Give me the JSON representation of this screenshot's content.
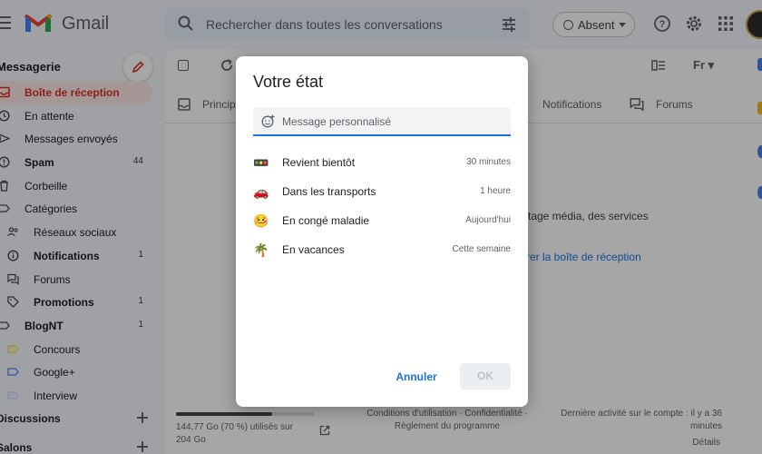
{
  "app": {
    "name": "Gmail"
  },
  "search": {
    "placeholder": "Rechercher dans toutes les conversations"
  },
  "status": {
    "label": "Absent"
  },
  "sidebar": {
    "section_title": "Messagerie",
    "items": [
      {
        "label": "Boîte de réception",
        "count": "",
        "icon": "inbox-icon"
      },
      {
        "label": "En attente",
        "count": "",
        "icon": "clock-icon"
      },
      {
        "label": "Messages envoyés",
        "count": "",
        "icon": "send-icon"
      },
      {
        "label": "Spam",
        "count": "44",
        "icon": "spam-icon"
      },
      {
        "label": "Corbeille",
        "count": "",
        "icon": "trash-icon"
      },
      {
        "label": "Catégories",
        "count": "",
        "icon": "label-icon"
      },
      {
        "label": "Réseaux sociaux",
        "count": "",
        "icon": "people-icon"
      },
      {
        "label": "Notifications",
        "count": "1",
        "icon": "info-icon"
      },
      {
        "label": "Forums",
        "count": "",
        "icon": "forum-icon"
      },
      {
        "label": "Promotions",
        "count": "1",
        "icon": "tag-icon"
      },
      {
        "label": "BlogNT",
        "count": "1",
        "icon": "label-icon"
      },
      {
        "label": "Concours",
        "count": "",
        "icon": "label-icon"
      },
      {
        "label": "Google+",
        "count": "",
        "icon": "label-icon"
      },
      {
        "label": "Interview",
        "count": "",
        "icon": "label-icon"
      }
    ],
    "discussions": "Discussions",
    "salons": "Salons"
  },
  "main": {
    "tabs": [
      "Princip",
      "Notifications",
      "Forums"
    ],
    "bg_text": "rtage média, des services",
    "bg_link": "rer la boîte de réception",
    "storage_text": "144,77 Go (70 %) utilisés sur 204 Go",
    "storage_pct": 70,
    "footer_terms": "Conditions d'utilisation · Confidentialité · Règlement du programme",
    "footer_activity": "Dernière activité sur le compte : il y a 36 minutes",
    "footer_details": "Détails"
  },
  "dialog": {
    "title": "Votre état",
    "input_placeholder": "Message personnalisé",
    "options": [
      {
        "label": "Revient bientôt",
        "time": "30 minutes",
        "icon": "🚥"
      },
      {
        "label": "Dans les transports",
        "time": "1 heure",
        "icon": "🚗"
      },
      {
        "label": "En congé maladie",
        "time": "Aujourd'hui",
        "icon": "🤒"
      },
      {
        "label": "En vacances",
        "time": "Cette semaine",
        "icon": "🌴"
      }
    ],
    "cancel_label": "Annuler",
    "ok_label": "OK"
  }
}
